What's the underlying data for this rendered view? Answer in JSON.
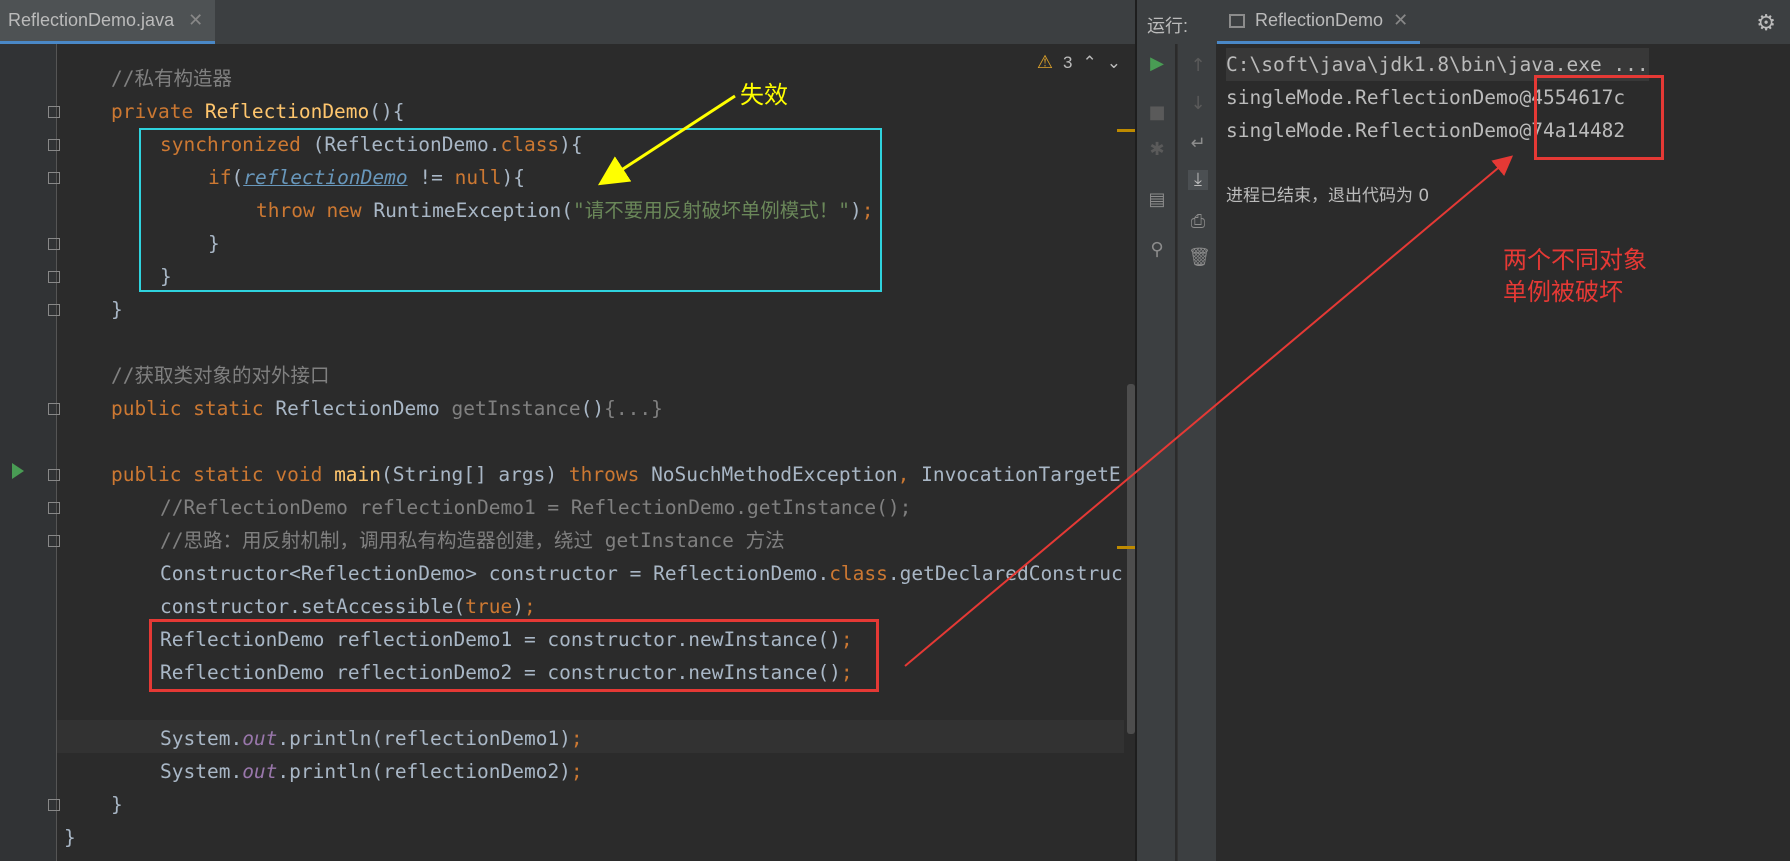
{
  "editor": {
    "tab_label": "ReflectionDemo.java",
    "tab_close": "✕",
    "warning_count": "3",
    "lines": [
      {
        "tokens": [
          {
            "c": "cm",
            "t": "//私有构造器"
          }
        ]
      },
      {
        "tokens": [
          {
            "c": "kw",
            "t": "private "
          },
          {
            "c": "fn",
            "t": "ReflectionDemo"
          },
          {
            "c": "pl",
            "t": "(){"
          }
        ]
      },
      {
        "tokens": [
          {
            "c": "kw",
            "t": "synchronized "
          },
          {
            "c": "pl",
            "t": "(ReflectionDemo."
          },
          {
            "c": "kw",
            "t": "class"
          },
          {
            "c": "pl",
            "t": "){"
          }
        ]
      },
      {
        "tokens": [
          {
            "c": "kw",
            "t": "if"
          },
          {
            "c": "pl",
            "t": "("
          },
          {
            "c": "fld-u",
            "t": "reflectionDemo"
          },
          {
            "c": "pl",
            "t": " != "
          },
          {
            "c": "kw",
            "t": "null"
          },
          {
            "c": "pl",
            "t": "){"
          }
        ]
      },
      {
        "tokens": [
          {
            "c": "kw",
            "t": "throw new "
          },
          {
            "c": "pl",
            "t": "RuntimeException("
          },
          {
            "c": "str",
            "t": "\"请不要用反射破坏单例模式！\""
          },
          {
            "c": "pl",
            "t": ")"
          },
          {
            "c": "kw",
            "t": ";"
          }
        ]
      },
      {
        "tokens": [
          {
            "c": "pl",
            "t": "}"
          }
        ]
      },
      {
        "tokens": [
          {
            "c": "pl",
            "t": "}"
          }
        ]
      },
      {
        "tokens": [
          {
            "c": "pl",
            "t": "}"
          }
        ]
      },
      {
        "tokens": []
      },
      {
        "tokens": [
          {
            "c": "cm",
            "t": "//获取类对象的对外接口"
          }
        ]
      },
      {
        "tokens": [
          {
            "c": "kw",
            "t": "public static "
          },
          {
            "c": "pl",
            "t": "ReflectionDemo "
          },
          {
            "c": "cm",
            "t": "getInstance"
          },
          {
            "c": "pl",
            "t": "()"
          },
          {
            "c": "cm",
            "t": "{...}"
          }
        ]
      },
      {
        "tokens": []
      },
      {
        "tokens": [
          {
            "c": "kw",
            "t": "public static void "
          },
          {
            "c": "fn",
            "t": "main"
          },
          {
            "c": "pl",
            "t": "(String[] args) "
          },
          {
            "c": "kw",
            "t": "throws "
          },
          {
            "c": "pl",
            "t": "NoSuchMethodException"
          },
          {
            "c": "kw",
            "t": ", "
          },
          {
            "c": "pl",
            "t": "InvocationTargetE"
          }
        ]
      },
      {
        "tokens": [
          {
            "c": "cm",
            "t": "//ReflectionDemo reflectionDemo1 = ReflectionDemo.getInstance();"
          }
        ]
      },
      {
        "tokens": [
          {
            "c": "cm",
            "t": "//思路：用反射机制，调用私有构造器创建，绕过 getInstance 方法"
          }
        ]
      },
      {
        "tokens": [
          {
            "c": "pl",
            "t": "Constructor<ReflectionDemo> constructor = ReflectionDemo."
          },
          {
            "c": "kw",
            "t": "class"
          },
          {
            "c": "pl",
            "t": ".getDeclaredConstruc"
          }
        ]
      },
      {
        "tokens": [
          {
            "c": "pl",
            "t": "constructor.setAccessible("
          },
          {
            "c": "kw",
            "t": "true"
          },
          {
            "c": "pl",
            "t": ")"
          },
          {
            "c": "kw",
            "t": ";"
          }
        ]
      },
      {
        "tokens": [
          {
            "c": "pl",
            "t": "ReflectionDemo reflectionDemo1 = constructor.newInstance()"
          },
          {
            "c": "kw",
            "t": ";"
          }
        ]
      },
      {
        "tokens": [
          {
            "c": "pl",
            "t": "ReflectionDemo reflectionDemo2 = constructor.newInstance()"
          },
          {
            "c": "kw",
            "t": ";"
          }
        ]
      },
      {
        "tokens": []
      },
      {
        "tokens": [
          {
            "c": "pl",
            "t": "System."
          },
          {
            "c": "fld",
            "t": "out"
          },
          {
            "c": "pl",
            "t": ".println(reflectionDemo1)"
          },
          {
            "c": "kw",
            "t": ";"
          }
        ]
      },
      {
        "tokens": [
          {
            "c": "pl",
            "t": "System."
          },
          {
            "c": "fld",
            "t": "out"
          },
          {
            "c": "pl",
            "t": ".println(reflectionDemo2)"
          },
          {
            "c": "kw",
            "t": ";"
          }
        ]
      },
      {
        "tokens": [
          {
            "c": "pl",
            "t": "}"
          }
        ]
      },
      {
        "tokens": [
          {
            "c": "pl",
            "t": "}"
          }
        ]
      }
    ]
  },
  "run": {
    "title": "运行:",
    "tab_label": "ReflectionDemo",
    "tab_close": "✕",
    "console_lines": [
      "C:\\soft\\java\\jdk1.8\\bin\\java.exe ...",
      "singleMode.ReflectionDemo@4554617c",
      "singleMode.ReflectionDemo@74a14482",
      "",
      "进程已结束，退出代码为 0"
    ]
  },
  "annotations": {
    "invalid_label": "失效",
    "broken_line1": "两个不同对象",
    "broken_line2": "单例被破坏"
  },
  "colors": {
    "keyword": "#cc7832",
    "method": "#ffc66d",
    "comment": "#808080",
    "string": "#6a8759",
    "cyan_box": "#2fd3de",
    "red_box": "#e53935",
    "yellow_arrow": "#ffff00"
  }
}
